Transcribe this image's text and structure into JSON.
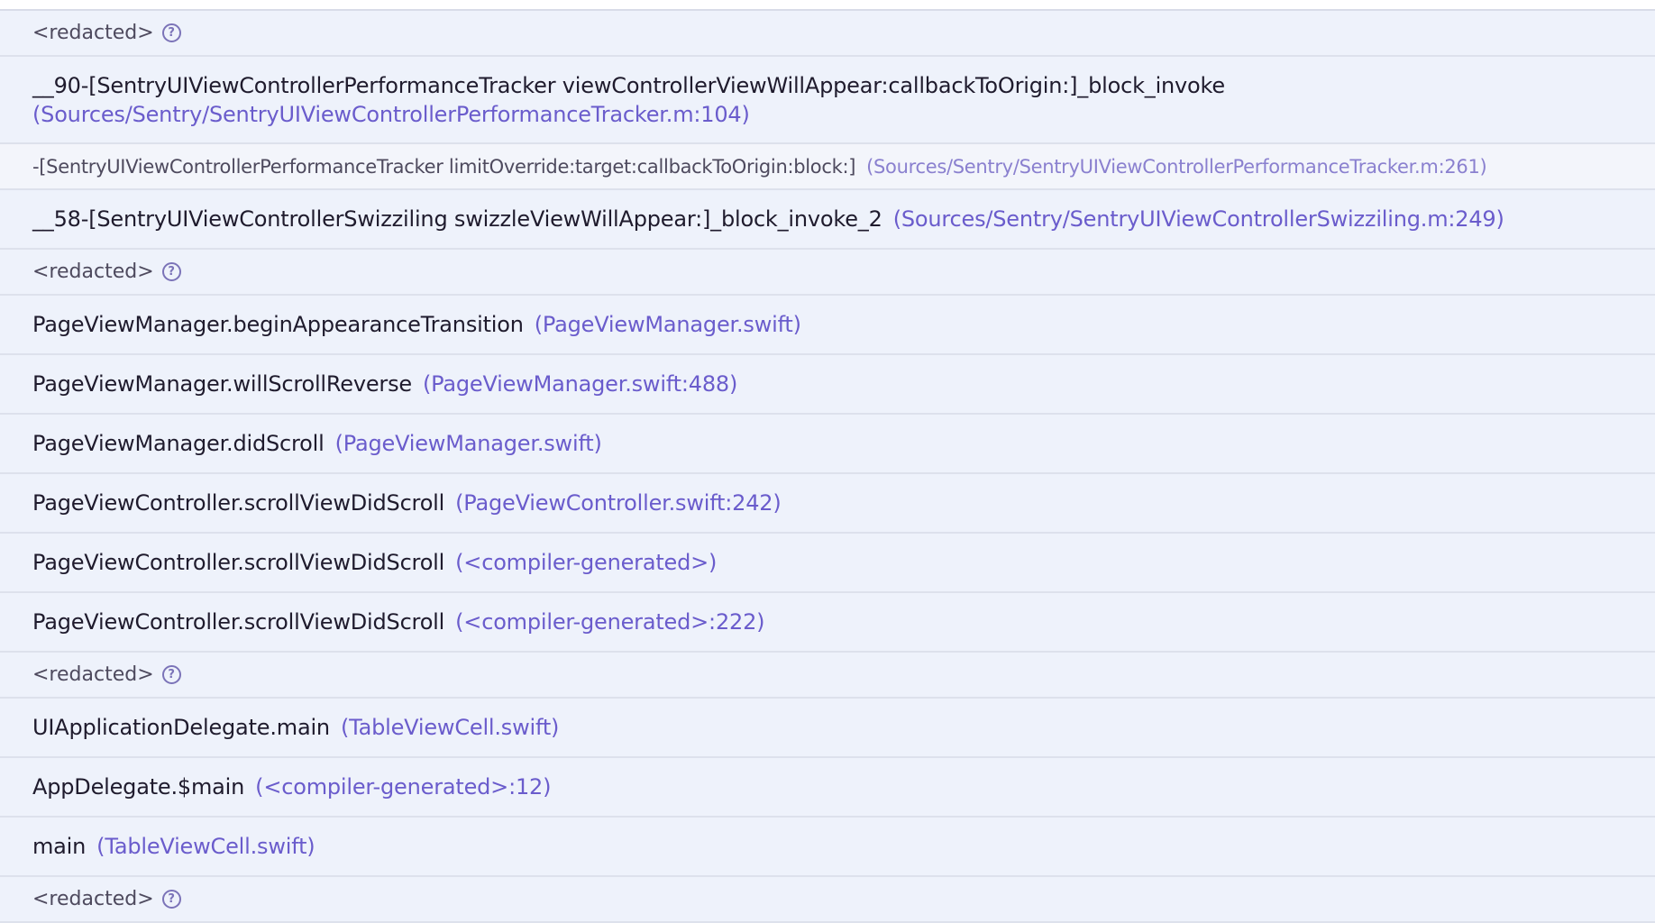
{
  "help_glyph": "?",
  "frames": [
    {
      "kind": "redacted",
      "label": "<redacted>"
    },
    {
      "kind": "app-wrap",
      "function": "__90-[SentryUIViewControllerPerformanceTracker viewControllerViewWillAppear:callbackToOrigin:]_block_invoke",
      "location": "(Sources/Sentry/SentryUIViewControllerPerformanceTracker.m:104)"
    },
    {
      "kind": "system",
      "function": "-[SentryUIViewControllerPerformanceTracker limitOverride:target:callbackToOrigin:block:]",
      "location": "(Sources/Sentry/SentryUIViewControllerPerformanceTracker.m:261)"
    },
    {
      "kind": "app",
      "function": "__58-[SentryUIViewControllerSwizziling swizzleViewWillAppear:]_block_invoke_2",
      "location": "(Sources/Sentry/SentryUIViewControllerSwizziling.m:249)"
    },
    {
      "kind": "redacted",
      "label": "<redacted>"
    },
    {
      "kind": "app",
      "function": "PageViewManager.beginAppearanceTransition",
      "location": "(PageViewManager.swift)"
    },
    {
      "kind": "app",
      "function": "PageViewManager.willScrollReverse",
      "location": "(PageViewManager.swift:488)"
    },
    {
      "kind": "app",
      "function": "PageViewManager.didScroll",
      "location": "(PageViewManager.swift)"
    },
    {
      "kind": "app",
      "function": "PageViewController.scrollViewDidScroll",
      "location": "(PageViewController.swift:242)"
    },
    {
      "kind": "app",
      "function": "PageViewController.scrollViewDidScroll",
      "location": "(<compiler-generated>)"
    },
    {
      "kind": "app",
      "function": "PageViewController.scrollViewDidScroll",
      "location": "(<compiler-generated>:222)"
    },
    {
      "kind": "redacted",
      "label": "<redacted>"
    },
    {
      "kind": "app",
      "function": "UIApplicationDelegate.main",
      "location": "(TableViewCell.swift)"
    },
    {
      "kind": "app",
      "function": "AppDelegate.$main",
      "location": "(<compiler-generated>:12)"
    },
    {
      "kind": "app",
      "function": "main",
      "location": "(TableViewCell.swift)"
    },
    {
      "kind": "redacted",
      "label": "<redacted>"
    }
  ]
}
